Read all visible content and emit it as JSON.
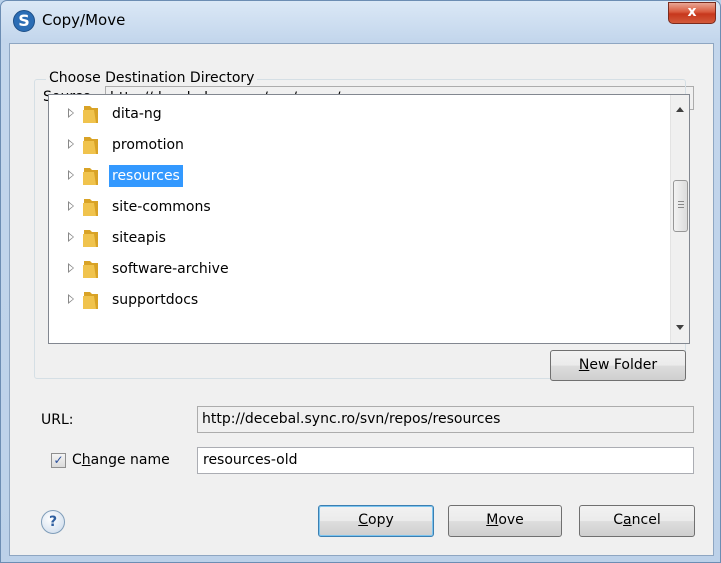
{
  "window": {
    "title": "Copy/Move",
    "close_glyph": "x"
  },
  "source": {
    "label": "Source",
    "value": "http://decebal.sync.ro/svn/repos/resources"
  },
  "destination": {
    "legend": "Choose Destination Directory",
    "items": [
      {
        "label": "dita-ng",
        "selected": false
      },
      {
        "label": "promotion",
        "selected": false
      },
      {
        "label": "resources",
        "selected": true
      },
      {
        "label": "site-commons",
        "selected": false
      },
      {
        "label": "siteapis",
        "selected": false
      },
      {
        "label": "software-archive",
        "selected": false
      },
      {
        "label": "supportdocs",
        "selected": false
      }
    ],
    "new_folder": {
      "mnemonic": "N",
      "rest": "ew Folder"
    }
  },
  "url": {
    "label": "URL:",
    "value": "http://decebal.sync.ro/svn/repos/resources"
  },
  "change_name": {
    "checked": true,
    "check_glyph": "✓",
    "label_pre": "C",
    "mnemonic": "h",
    "label_post": "ange name",
    "value": "resources-old"
  },
  "help": {
    "glyph": "?"
  },
  "buttons": {
    "copy": {
      "mnemonic": "C",
      "rest": "opy"
    },
    "move": {
      "mnemonic": "M",
      "rest": "ove"
    },
    "cancel": {
      "pre": "C",
      "mnemonic": "a",
      "rest": "ncel"
    }
  },
  "colors": {
    "selection": "#3399ff",
    "folder": "#f0c34d"
  },
  "icons": [
    "app-icon",
    "close-icon",
    "expander-icon",
    "folder-icon",
    "help-icon",
    "checkbox-check-icon"
  ]
}
